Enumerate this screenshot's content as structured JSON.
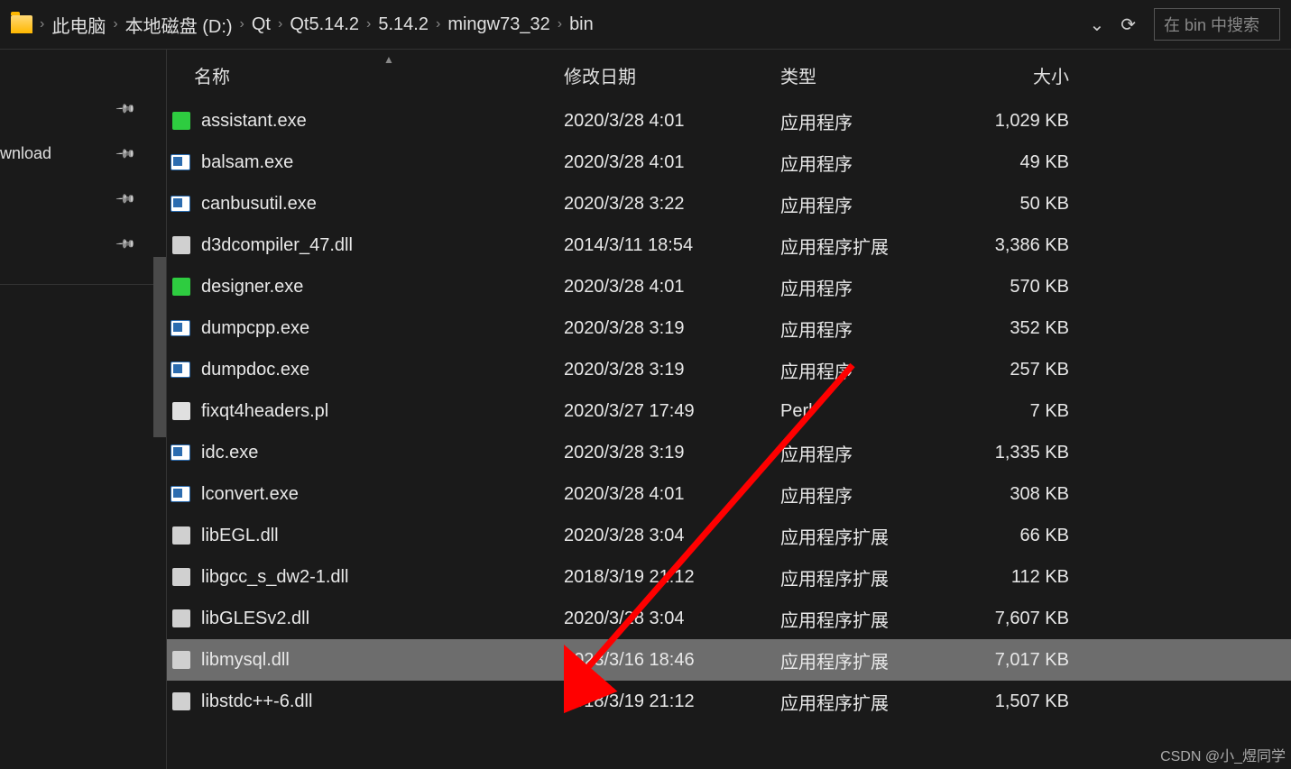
{
  "breadcrumb": {
    "items": [
      "此电脑",
      "本地磁盘 (D:)",
      "Qt",
      "Qt5.14.2",
      "5.14.2",
      "mingw73_32",
      "bin"
    ]
  },
  "search": {
    "placeholder": "在 bin 中搜索"
  },
  "sidebar": {
    "items": [
      {
        "label": ""
      },
      {
        "label": "wnload"
      },
      {
        "label": ""
      },
      {
        "label": ""
      }
    ]
  },
  "columns": {
    "name": "名称",
    "date": "修改日期",
    "type": "类型",
    "size": "大小"
  },
  "files": [
    {
      "icon": "green",
      "name": "assistant.exe",
      "date": "2020/3/28 4:01",
      "type": "应用程序",
      "size": "1,029 KB",
      "selected": false
    },
    {
      "icon": "blue",
      "name": "balsam.exe",
      "date": "2020/3/28 4:01",
      "type": "应用程序",
      "size": "49 KB",
      "selected": false
    },
    {
      "icon": "blue",
      "name": "canbusutil.exe",
      "date": "2020/3/28 3:22",
      "type": "应用程序",
      "size": "50 KB",
      "selected": false
    },
    {
      "icon": "gear",
      "name": "d3dcompiler_47.dll",
      "date": "2014/3/11 18:54",
      "type": "应用程序扩展",
      "size": "3,386 KB",
      "selected": false
    },
    {
      "icon": "green",
      "name": "designer.exe",
      "date": "2020/3/28 4:01",
      "type": "应用程序",
      "size": "570 KB",
      "selected": false
    },
    {
      "icon": "blue",
      "name": "dumpcpp.exe",
      "date": "2020/3/28 3:19",
      "type": "应用程序",
      "size": "352 KB",
      "selected": false
    },
    {
      "icon": "blue",
      "name": "dumpdoc.exe",
      "date": "2020/3/28 3:19",
      "type": "应用程序",
      "size": "257 KB",
      "selected": false
    },
    {
      "icon": "file",
      "name": "fixqt4headers.pl",
      "date": "2020/3/27 17:49",
      "type": "Perl",
      "size": "7 KB",
      "selected": false
    },
    {
      "icon": "blue",
      "name": "idc.exe",
      "date": "2020/3/28 3:19",
      "type": "应用程序",
      "size": "1,335 KB",
      "selected": false
    },
    {
      "icon": "blue",
      "name": "lconvert.exe",
      "date": "2020/3/28 4:01",
      "type": "应用程序",
      "size": "308 KB",
      "selected": false
    },
    {
      "icon": "gear",
      "name": "libEGL.dll",
      "date": "2020/3/28 3:04",
      "type": "应用程序扩展",
      "size": "66 KB",
      "selected": false
    },
    {
      "icon": "gear",
      "name": "libgcc_s_dw2-1.dll",
      "date": "2018/3/19 21:12",
      "type": "应用程序扩展",
      "size": "112 KB",
      "selected": false
    },
    {
      "icon": "gear",
      "name": "libGLESv2.dll",
      "date": "2020/3/28 3:04",
      "type": "应用程序扩展",
      "size": "7,607 KB",
      "selected": false
    },
    {
      "icon": "gear",
      "name": "libmysql.dll",
      "date": "2023/3/16 18:46",
      "type": "应用程序扩展",
      "size": "7,017 KB",
      "selected": true
    },
    {
      "icon": "gear",
      "name": "libstdc++-6.dll",
      "date": "2018/3/19 21:12",
      "type": "应用程序扩展",
      "size": "1,507 KB",
      "selected": false
    }
  ],
  "watermark": "CSDN @小_煜同学"
}
